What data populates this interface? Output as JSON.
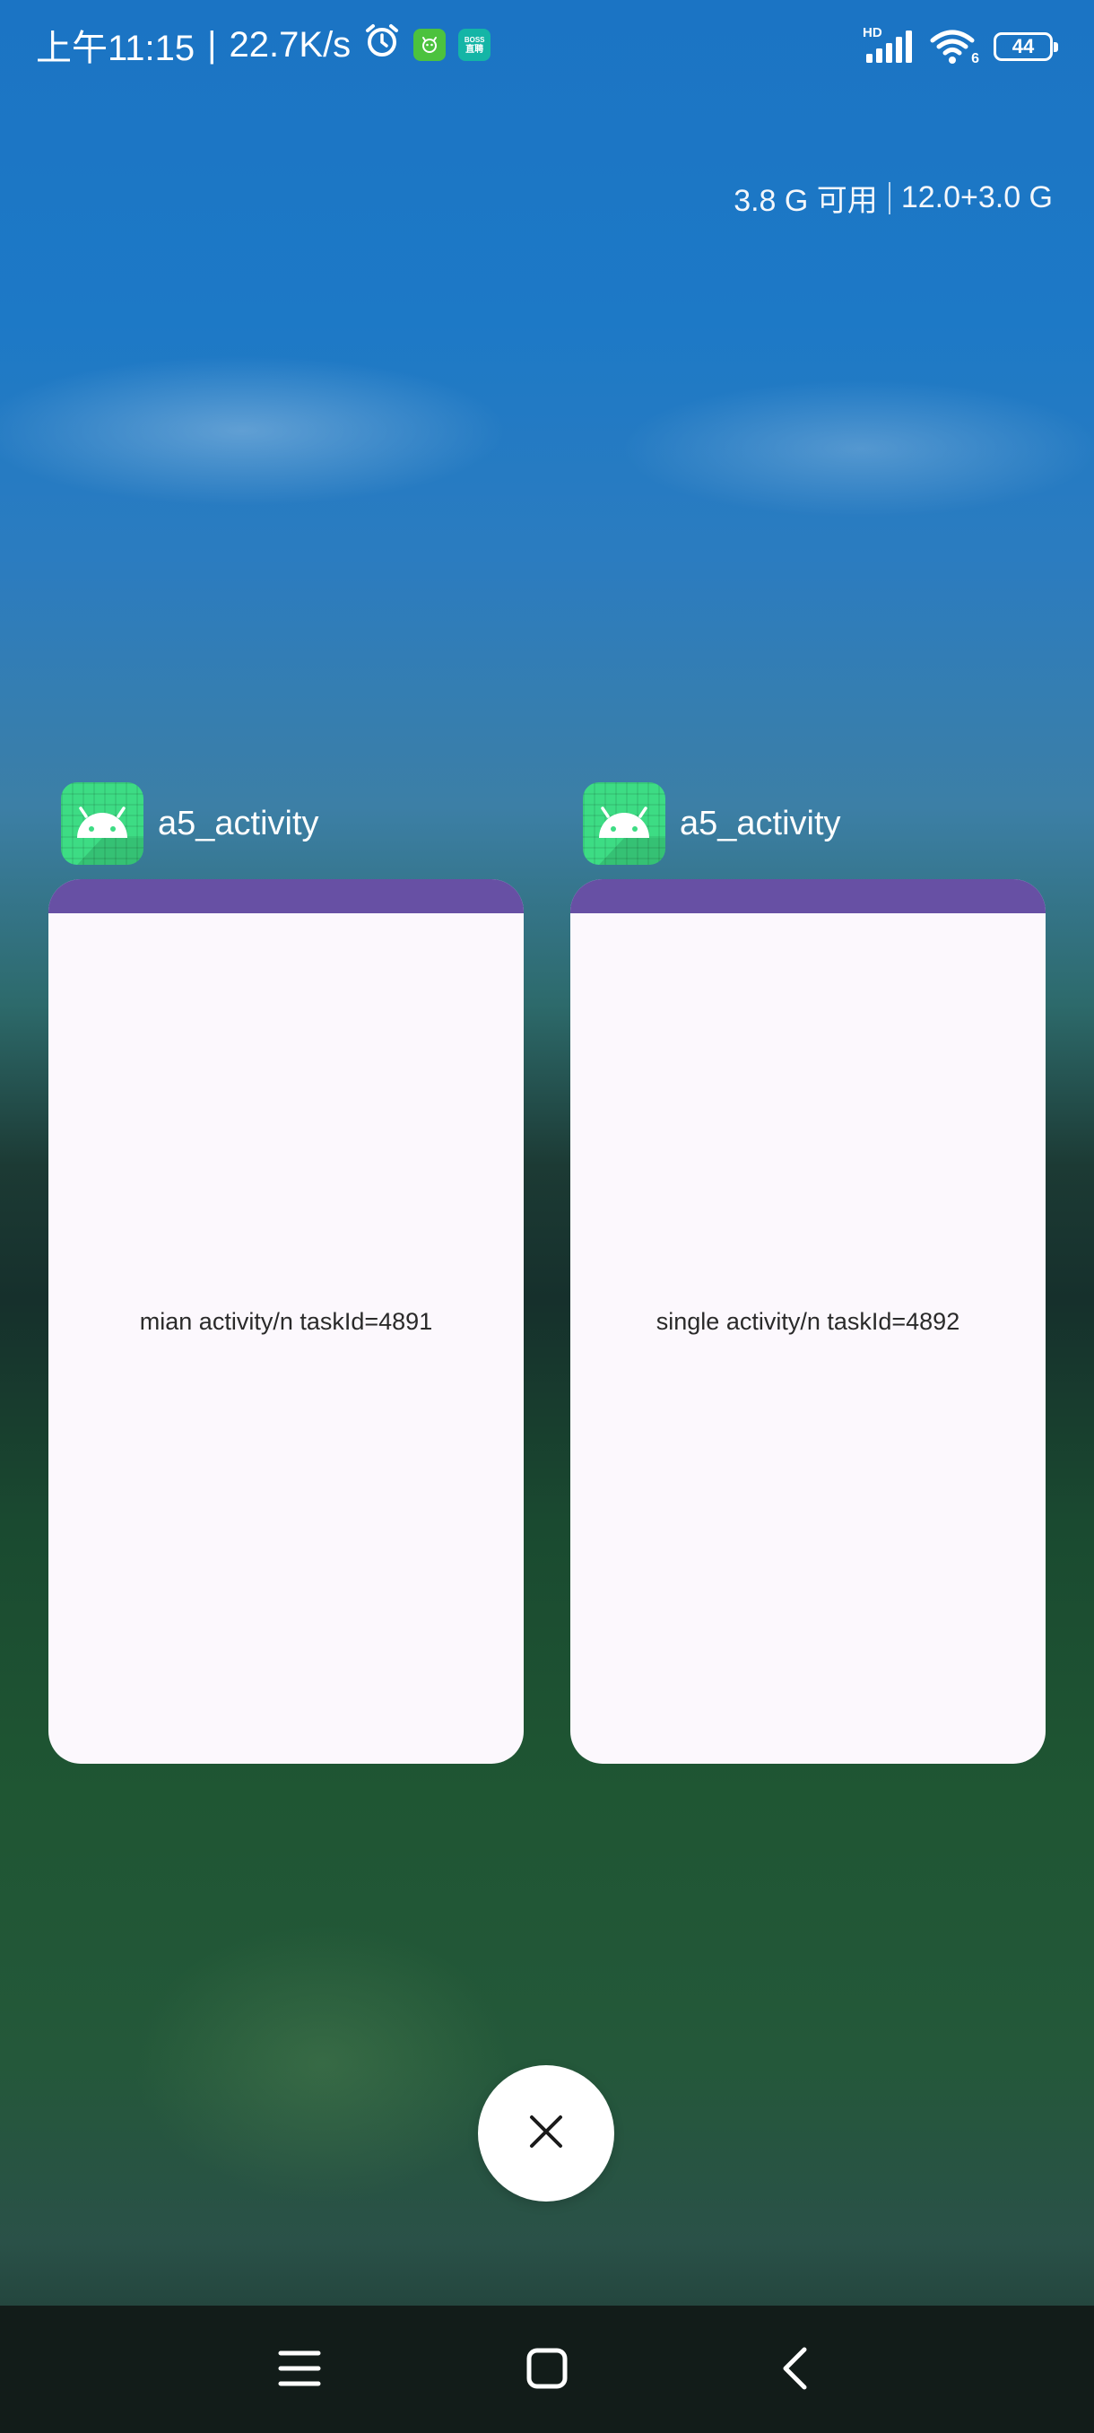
{
  "status_bar": {
    "time": "上午11:15",
    "separator": "|",
    "network_speed": "22.7K/s",
    "boss_icon_text_top": "BOSS",
    "boss_icon_text_bottom": "直聘",
    "hd_label": "HD",
    "wifi_badge": "6",
    "battery_level": "44",
    "icons": [
      "alarm-icon",
      "app-notification-icon",
      "boss-zhipin-icon",
      "hd-signal-icon",
      "wifi-icon",
      "battery-icon"
    ]
  },
  "memory": {
    "available": "3.8 G 可用",
    "total": "12.0+3.0 G"
  },
  "recent_apps": [
    {
      "app_name": "a5_activity",
      "content_text": "mian activity/n taskId=4891",
      "icon": "android-icon"
    },
    {
      "app_name": "a5_activity",
      "content_text": "single activity/n taskId=4892",
      "icon": "android-icon"
    }
  ],
  "clear_all": {
    "icon": "close-icon"
  },
  "navigation": {
    "buttons": [
      "menu-icon",
      "home-icon",
      "back-icon"
    ]
  },
  "colors": {
    "card_topbar": "#6750a4",
    "card_background": "#fcf8fd",
    "android_icon_green": "#3ddc84",
    "navbar_background": "#121c19"
  }
}
